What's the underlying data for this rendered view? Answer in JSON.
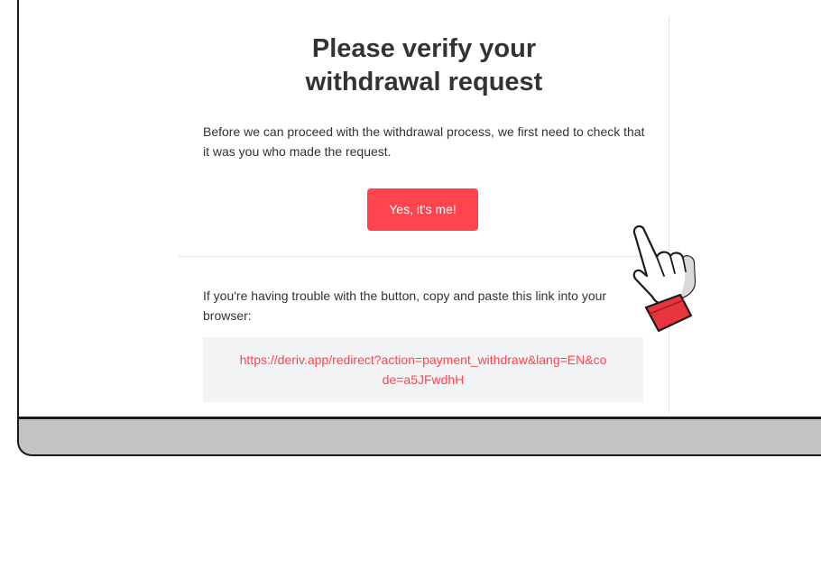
{
  "email": {
    "title_line1": "Please verify your",
    "title_line2": "withdrawal request",
    "intro_text": "Before we can proceed with the withdrawal process, we first need to check that it was you who made the request.",
    "confirm_button_label": "Yes, it's me!",
    "trouble_text": "If you're having trouble with the button, copy and paste this link into your browser:",
    "link_text": "https://deriv.app/redirect?action=payment_withdraw&lang=EN&code=a5JFwdhH"
  },
  "colors": {
    "accent": "#ff444f",
    "text": "#333333",
    "link_box_bg": "#f2f3f4",
    "bezel": "#c3c3c3",
    "frame": "#1b1b1b"
  },
  "icons": {
    "pointer": "pointing-hand-icon"
  }
}
